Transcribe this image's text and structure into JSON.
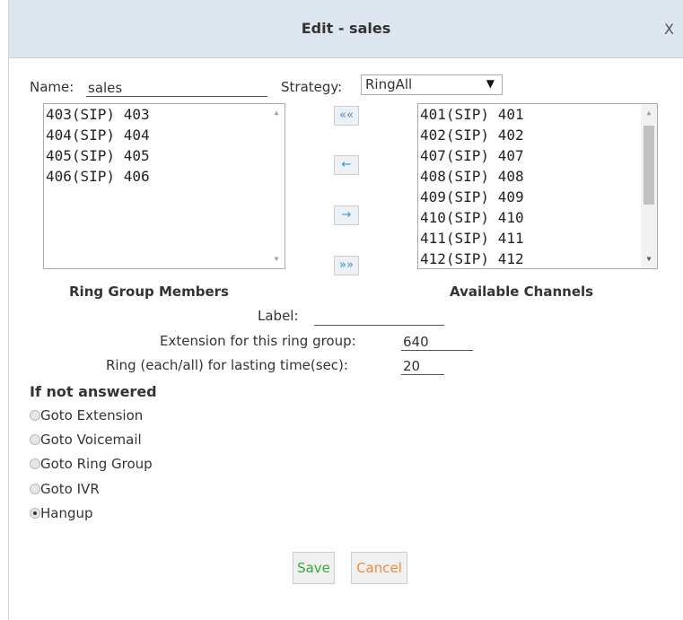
{
  "dialog": {
    "title": "Edit - sales",
    "close_label": "X"
  },
  "form": {
    "name_label": "Name:",
    "name_value": "sales",
    "strategy_label": "Strategy:",
    "strategy_value": "RingAll",
    "members_caption": "Ring Group Members",
    "available_caption": "Available Channels",
    "label_label": "Label:",
    "label_value": "",
    "extension_label": "Extension for this ring group:",
    "extension_value": "640",
    "ringtime_label": "Ring (each/all) for lasting time(sec):",
    "ringtime_value": "20"
  },
  "members": [
    "403(SIP) 403",
    "404(SIP) 404",
    "405(SIP) 405",
    "406(SIP) 406"
  ],
  "available": [
    "401(SIP) 401",
    "402(SIP) 402",
    "407(SIP) 407",
    "408(SIP) 408",
    "409(SIP) 409",
    "410(SIP) 410",
    "411(SIP) 411",
    "412(SIP) 412"
  ],
  "move_buttons": {
    "all_left": "««",
    "left": "←",
    "right": "→",
    "all_right": "»»"
  },
  "not_answered": {
    "title": "If not answered",
    "options": [
      "Goto Extension",
      "Goto Voicemail",
      "Goto Ring Group",
      "Goto IVR",
      "Hangup"
    ],
    "selected": "Hangup"
  },
  "buttons": {
    "save": "Save",
    "cancel": "Cancel"
  },
  "colors": {
    "titlebar": "#dde6ee",
    "save_text": "#3aa83a",
    "cancel_text": "#f08a3c",
    "move_arrow": "#3a8fd8"
  }
}
